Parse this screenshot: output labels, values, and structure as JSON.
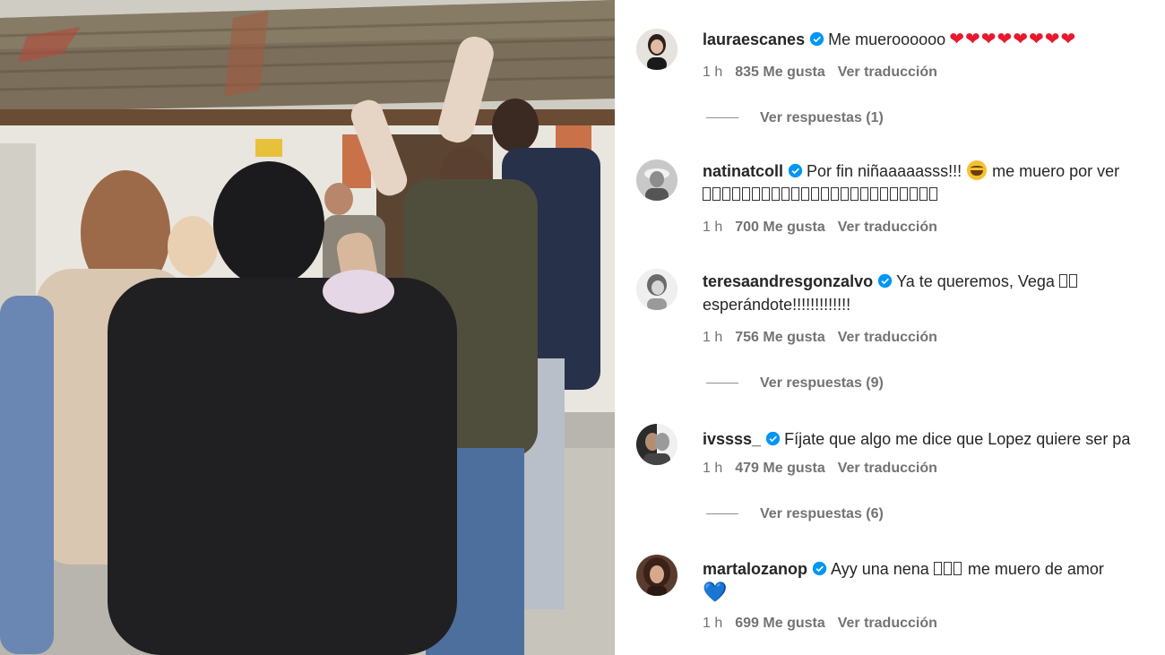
{
  "comments": [
    {
      "username": "lauraescanes",
      "text": "Me mueroooooo",
      "hearts": "❤❤❤❤❤❤❤❤",
      "time": "1 h",
      "likes": "835 Me gusta",
      "translate": "Ver traducción",
      "replies": "Ver respuestas (1)"
    },
    {
      "username": "natinatcoll",
      "text_before": "Por fin niñaaaaasss!!!",
      "text_after": "me muero por ver",
      "emoji": "laughing-emoji",
      "time": "1 h",
      "likes": "700 Me gusta",
      "translate": "Ver traducción"
    },
    {
      "username": "teresaandresgonzalvo",
      "text": "Ya te queremos, Vega",
      "line2": "esperándote!!!!!!!!!!!!!",
      "time": "1 h",
      "likes": "756 Me gusta",
      "translate": "Ver traducción",
      "replies": "Ver respuestas (9)"
    },
    {
      "username": "ivssss_",
      "text": "Fíjate que algo me dice que Lopez quiere ser pa",
      "time": "1 h",
      "likes": "479 Me gusta",
      "translate": "Ver traducción",
      "replies": "Ver respuestas (6)"
    },
    {
      "username": "martalozanop",
      "text_before": "Ayy una nena",
      "text_after": "me muero de amor",
      "line2_heart": "💙",
      "time": "1 h",
      "likes": "699 Me gusta",
      "translate": "Ver traducción"
    }
  ],
  "colors": {
    "verified": "#0095f6",
    "heart": "#e8192c",
    "meta": "#737373",
    "text": "#262626"
  }
}
